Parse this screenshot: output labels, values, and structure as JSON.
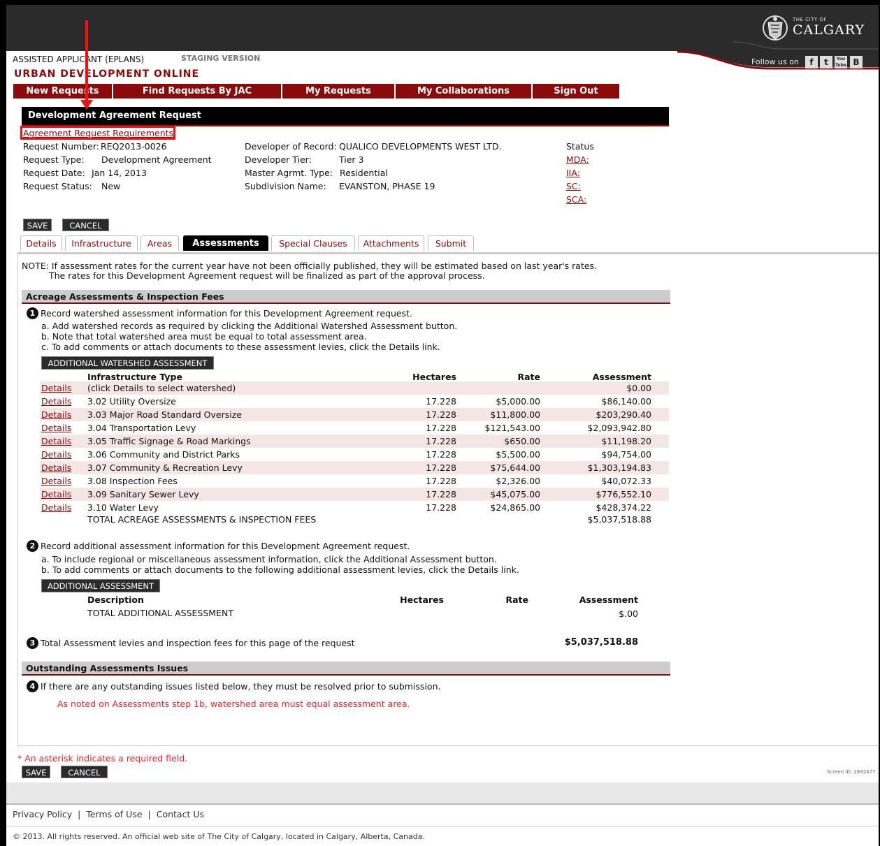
{
  "header": {
    "logo_small": "THE CITY OF",
    "logo_big": "CALGARY",
    "follow_label": "Follow us on",
    "social": [
      "f",
      "t",
      "You Tube",
      "B"
    ],
    "user": "ASSISTED APPLICANT (EPLANS)",
    "staging": "STAGING VERSION",
    "app_title": "URBAN DEVELOPMENT ONLINE"
  },
  "nav": [
    "New Requests",
    "Find Requests By JAC",
    "My Requests",
    "My Collaborations",
    "Sign Out"
  ],
  "page": {
    "bar_title": "Development Agreement Request",
    "requirements_link": "Agreement Request Requirements"
  },
  "request_info": {
    "left": [
      {
        "label": "Request Number:",
        "value": "REQ2013-0026"
      },
      {
        "label": "Request Type:",
        "value": "Development Agreement"
      },
      {
        "label": "Request Date:",
        "value": "Jan 14, 2013"
      },
      {
        "label": "Request Status:",
        "value": "New"
      }
    ],
    "middle": [
      {
        "label": "Developer of Record:",
        "value": "QUALICO DEVELOPMENTS WEST LTD."
      },
      {
        "label": "Developer Tier:",
        "value": "Tier 3"
      },
      {
        "label": "Master Agrmt. Type:",
        "value": "Residential"
      },
      {
        "label": "Subdivision Name:",
        "value": "EVANSTON, PHASE 19"
      }
    ],
    "status_label": "Status",
    "status_links": [
      "MDA:",
      "IIA:",
      "SC:",
      "SCA:"
    ]
  },
  "buttons": {
    "save": "SAVE",
    "cancel": "CANCEL"
  },
  "tabs": [
    "Details",
    "Infrastructure",
    "Areas",
    "Assessments",
    "Special Clauses",
    "Attachments",
    "Submit"
  ],
  "note": {
    "line1": "NOTE: If assessment rates for the current year have not been officially published, they will be estimated based on last year's rates.",
    "line2": "The rates for this Development Agreement request will be finalized as part of the approval process."
  },
  "section1": {
    "title": "Acreage Assessments & Inspection Fees",
    "step1_num": "1",
    "step1_text": "Record watershed assessment information for this Development Agreement request.",
    "step1_a": "a. Add watershed records as required by clicking the Additional Watershed Assessment button.",
    "step1_b": "b. Note that total watershed area must be equal to total assessment area.",
    "step1_c": "c. To add comments or attach documents to these assessment levies, click the Details link.",
    "watershed_button": "ADDITIONAL WATERSHED ASSESSMENT",
    "columns": {
      "type": "Infrastructure Type",
      "hectares": "Hectares",
      "rate": "Rate",
      "assessment": "Assessment"
    },
    "details_label": "Details",
    "rows": [
      {
        "type": "(click Details to select watershed)",
        "hectares": "",
        "rate": "",
        "assessment": "$0.00"
      },
      {
        "type": "3.02 Utility Oversize",
        "hectares": "17.228",
        "rate": "$5,000.00",
        "assessment": "$86,140.00"
      },
      {
        "type": "3.03 Major Road Standard Oversize",
        "hectares": "17.228",
        "rate": "$11,800.00",
        "assessment": "$203,290.40"
      },
      {
        "type": "3.04 Transportation Levy",
        "hectares": "17.228",
        "rate": "$121,543.00",
        "assessment": "$2,093,942.80"
      },
      {
        "type": "3.05 Traffic Signage & Road Markings",
        "hectares": "17.228",
        "rate": "$650.00",
        "assessment": "$11,198.20"
      },
      {
        "type": "3.06 Community and District Parks",
        "hectares": "17.228",
        "rate": "$5,500.00",
        "assessment": "$94,754.00"
      },
      {
        "type": "3.07 Community & Recreation Levy",
        "hectares": "17.228",
        "rate": "$75,644.00",
        "assessment": "$1,303,194.83"
      },
      {
        "type": "3.08 Inspection Fees",
        "hectares": "17.228",
        "rate": "$2,326.00",
        "assessment": "$40,072.33"
      },
      {
        "type": "3.09 Sanitary Sewer Levy",
        "hectares": "17.228",
        "rate": "$45,075.00",
        "assessment": "$776,552.10"
      },
      {
        "type": "3.10 Water Levy",
        "hectares": "17.228",
        "rate": "$24,865.00",
        "assessment": "$428,374.22"
      }
    ],
    "total_label": "TOTAL ACREAGE ASSESSMENTS & INSPECTION FEES",
    "total_value": "$5,037,518.88",
    "step2_num": "2",
    "step2_text": "Record additional assessment information for this Development Agreement request.",
    "step2_a": "a. To include regional or miscellaneous assessment information, click the Additional Assessment button.",
    "step2_b": "b. To add comments or attach documents to the following additional assessment levies, click the Details link.",
    "additional_button": "ADDITIONAL ASSESSMENT",
    "add_columns": {
      "description": "Description",
      "hectares": "Hectares",
      "rate": "Rate",
      "assessment": "Assessment"
    },
    "add_total_label": "TOTAL ADDITIONAL ASSESSMENT",
    "add_total_value": "$.00",
    "step3_num": "3",
    "step3_text": "Total Assessment levies and inspection fees for this page of the request",
    "step3_value": "$5,037,518.88"
  },
  "section2": {
    "title": "Outstanding Assessments Issues",
    "step4_num": "4",
    "step4_text": "If there are any outstanding issues listed below, they must be resolved prior to submission.",
    "issue": "As noted on Assessments step 1b, watershed area must equal assessment area."
  },
  "footer": {
    "asterisk_mark": "*",
    "asterisk_text": " An asterisk indicates a required field.",
    "screen_id": "Screen ID: 2892477",
    "links": [
      "Privacy Policy",
      "Terms of Use",
      "Contact Us"
    ],
    "separator": "|",
    "copyright": "© 2013. All rights reserved. An official web site of The City of Calgary, located in Calgary, Alberta, Canada."
  },
  "colors": {
    "brand": "#8b0a0a",
    "alert": "#e22",
    "highlight": "#e11",
    "row_alt": "#f5e6e6"
  }
}
